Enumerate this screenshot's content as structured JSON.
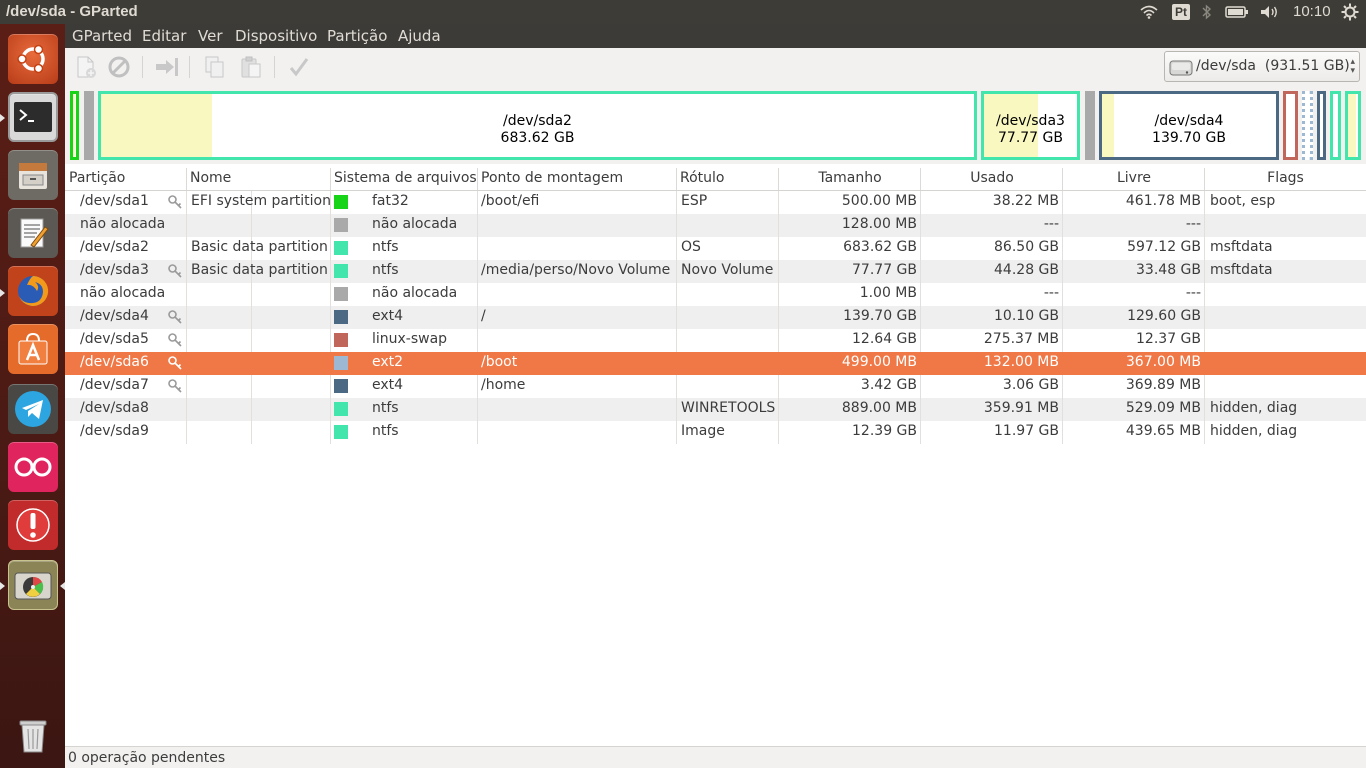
{
  "window": {
    "title": "/dev/sda - GParted"
  },
  "panel": {
    "keyboard_indicator": "Pt",
    "clock": "10:10",
    "icons": [
      "wifi-icon",
      "keyboard-layout-indicator",
      "bluetooth-icon",
      "battery-icon",
      "volume-icon",
      "settings-gear-icon"
    ]
  },
  "launcher": {
    "items": [
      "ubuntu-dash",
      "terminal",
      "file-manager",
      "text-editor",
      "firefox",
      "software-center",
      "telegram",
      "flickr",
      "error-reporter",
      "gparted",
      "trash"
    ]
  },
  "menubar": {
    "items": [
      "GParted",
      "Editar",
      "Ver",
      "Dispositivo",
      "Partição",
      "Ajuda"
    ]
  },
  "toolbar": {
    "buttons": [
      "new-partition",
      "delete-partition",
      "resize-move",
      "copy",
      "paste",
      "apply-operations"
    ],
    "device_selector": {
      "device": "/dev/sda",
      "size": "(931.51 GB)"
    }
  },
  "map": {
    "sda2": {
      "name": "/dev/sda2",
      "size": "683.62 GB"
    },
    "sda3": {
      "name": "/dev/sda3",
      "size": "77.77 GB"
    },
    "sda4": {
      "name": "/dev/sda4",
      "size": "139.70 GB"
    }
  },
  "colors": {
    "fat32": "#18d418",
    "unallocated": "#a9a9a9",
    "ntfs": "#42e5ac",
    "ext4": "#4b6983",
    "linux_swap": "#c1665a",
    "ext2": "#9db8d2",
    "selection": "#f07746",
    "used_space": "#f8f8c0"
  },
  "table": {
    "headers": [
      "Partição",
      "Nome",
      "Sistema de arquivos",
      "Ponto de montagem",
      "Rótulo",
      "Tamanho",
      "Usado",
      "Livre",
      "Flags"
    ],
    "rows": [
      {
        "partition": "/dev/sda1",
        "key": true,
        "name": "EFI system partition",
        "fs": "fat32",
        "fs_color": "#18d418",
        "mount": "/boot/efi",
        "label": "ESP",
        "size": "500.00 MB",
        "used": "38.22 MB",
        "free": "461.78 MB",
        "flags": "boot, esp"
      },
      {
        "partition": "não alocada",
        "key": false,
        "name": "",
        "fs": "não alocada",
        "fs_color": "#a9a9a9",
        "mount": "",
        "label": "",
        "size": "128.00 MB",
        "used": "---",
        "free": "---",
        "flags": ""
      },
      {
        "partition": "/dev/sda2",
        "key": false,
        "name": "Basic data partition",
        "fs": "ntfs",
        "fs_color": "#42e5ac",
        "mount": "",
        "label": "OS",
        "size": "683.62 GB",
        "used": "86.50 GB",
        "free": "597.12 GB",
        "flags": "msftdata"
      },
      {
        "partition": "/dev/sda3",
        "key": true,
        "name": "Basic data partition",
        "fs": "ntfs",
        "fs_color": "#42e5ac",
        "mount": "/media/perso/Novo Volume",
        "label": "Novo Volume",
        "size": "77.77 GB",
        "used": "44.28 GB",
        "free": "33.48 GB",
        "flags": "msftdata"
      },
      {
        "partition": "não alocada",
        "key": false,
        "name": "",
        "fs": "não alocada",
        "fs_color": "#a9a9a9",
        "mount": "",
        "label": "",
        "size": "1.00 MB",
        "used": "---",
        "free": "---",
        "flags": ""
      },
      {
        "partition": "/dev/sda4",
        "key": true,
        "name": "",
        "fs": "ext4",
        "fs_color": "#4b6983",
        "mount": "/",
        "label": "",
        "size": "139.70 GB",
        "used": "10.10 GB",
        "free": "129.60 GB",
        "flags": ""
      },
      {
        "partition": "/dev/sda5",
        "key": true,
        "name": "",
        "fs": "linux-swap",
        "fs_color": "#c1665a",
        "mount": "",
        "label": "",
        "size": "12.64 GB",
        "used": "275.37 MB",
        "free": "12.37 GB",
        "flags": ""
      },
      {
        "partition": "/dev/sda6",
        "key": true,
        "name": "",
        "fs": "ext2",
        "fs_color": "#9db8d2",
        "mount": "/boot",
        "label": "",
        "size": "499.00 MB",
        "used": "132.00 MB",
        "free": "367.00 MB",
        "flags": ""
      },
      {
        "partition": "/dev/sda7",
        "key": true,
        "name": "",
        "fs": "ext4",
        "fs_color": "#4b6983",
        "mount": "/home",
        "label": "",
        "size": "3.42 GB",
        "used": "3.06 GB",
        "free": "369.89 MB",
        "flags": ""
      },
      {
        "partition": "/dev/sda8",
        "key": false,
        "name": "",
        "fs": "ntfs",
        "fs_color": "#42e5ac",
        "mount": "",
        "label": "WINRETOOLS",
        "size": "889.00 MB",
        "used": "359.91 MB",
        "free": "529.09 MB",
        "flags": "hidden, diag"
      },
      {
        "partition": "/dev/sda9",
        "key": false,
        "name": "",
        "fs": "ntfs",
        "fs_color": "#42e5ac",
        "mount": "",
        "label": "Image",
        "size": "12.39 GB",
        "used": "11.97 GB",
        "free": "439.65 MB",
        "flags": "hidden, diag"
      }
    ],
    "selected_row": 7
  },
  "status": {
    "text": "0 operação pendentes"
  }
}
